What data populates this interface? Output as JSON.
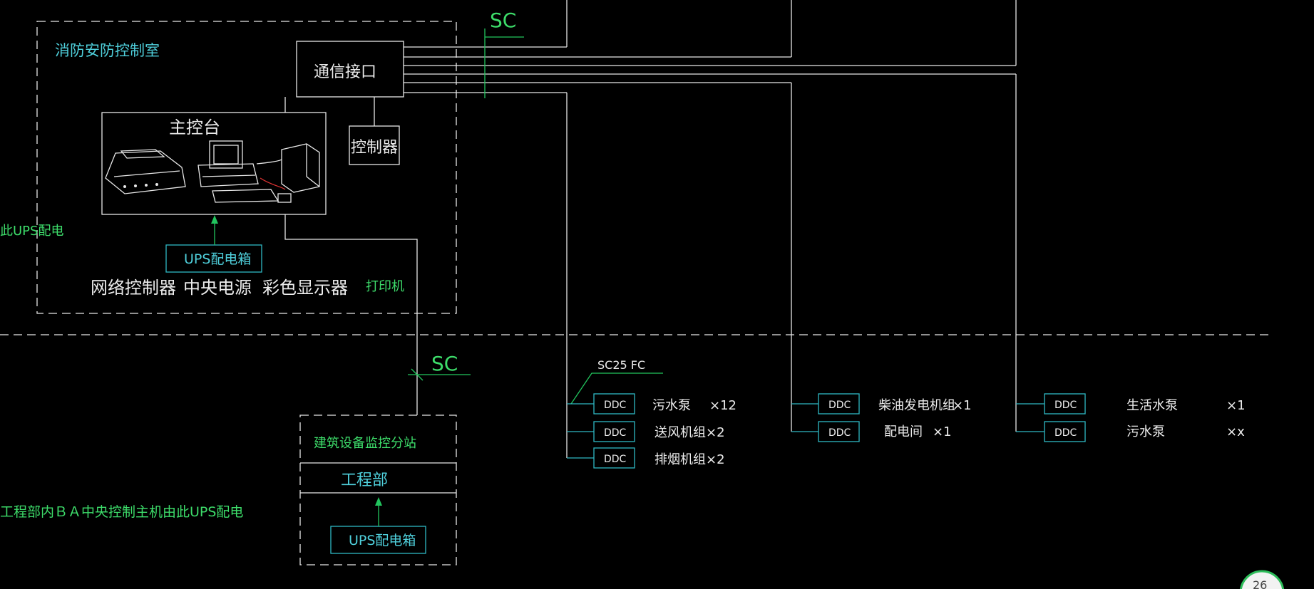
{
  "control_room": {
    "title": "消防安防控制室",
    "comm_interface": "通信接口",
    "controller": "控制器",
    "console": "主控台",
    "ups_box": "UPS配电箱",
    "equipment_labels": [
      "网络控制器",
      "中央电源",
      "彩色显示器",
      "打印机"
    ]
  },
  "left_notes": {
    "ups_note": "此UPS配电",
    "ba_note": "工程部内ＢＡ中央控制主机由此UPS配电"
  },
  "conduit": {
    "top": "SC",
    "mid": "SC",
    "ddc_feed": "SC25 FC"
  },
  "sub_station": {
    "title": "建筑设备监控分站",
    "dept": "工程部",
    "ups_box": "UPS配电箱"
  },
  "ddc_label": "DDC",
  "ddc_groups": [
    {
      "items": [
        {
          "name": "污水泵",
          "qty": "×12"
        },
        {
          "name": "送风机组",
          "qty": "×2"
        },
        {
          "name": "排烟机组",
          "qty": "×2"
        }
      ]
    },
    {
      "items": [
        {
          "name": "柴油发电机组",
          "qty": "×1"
        },
        {
          "name": "配电间",
          "qty": "×1"
        }
      ]
    },
    {
      "items": [
        {
          "name": "生活水泵",
          "qty": "×1"
        },
        {
          "name": "污水泵",
          "qty": "×x"
        }
      ]
    }
  ],
  "corner_badge": "26",
  "colors": {
    "background": "#000000",
    "line": "#e8e8e8",
    "annotation_green": "#3ddc6a",
    "label_cyan": "#4fd0dc"
  }
}
